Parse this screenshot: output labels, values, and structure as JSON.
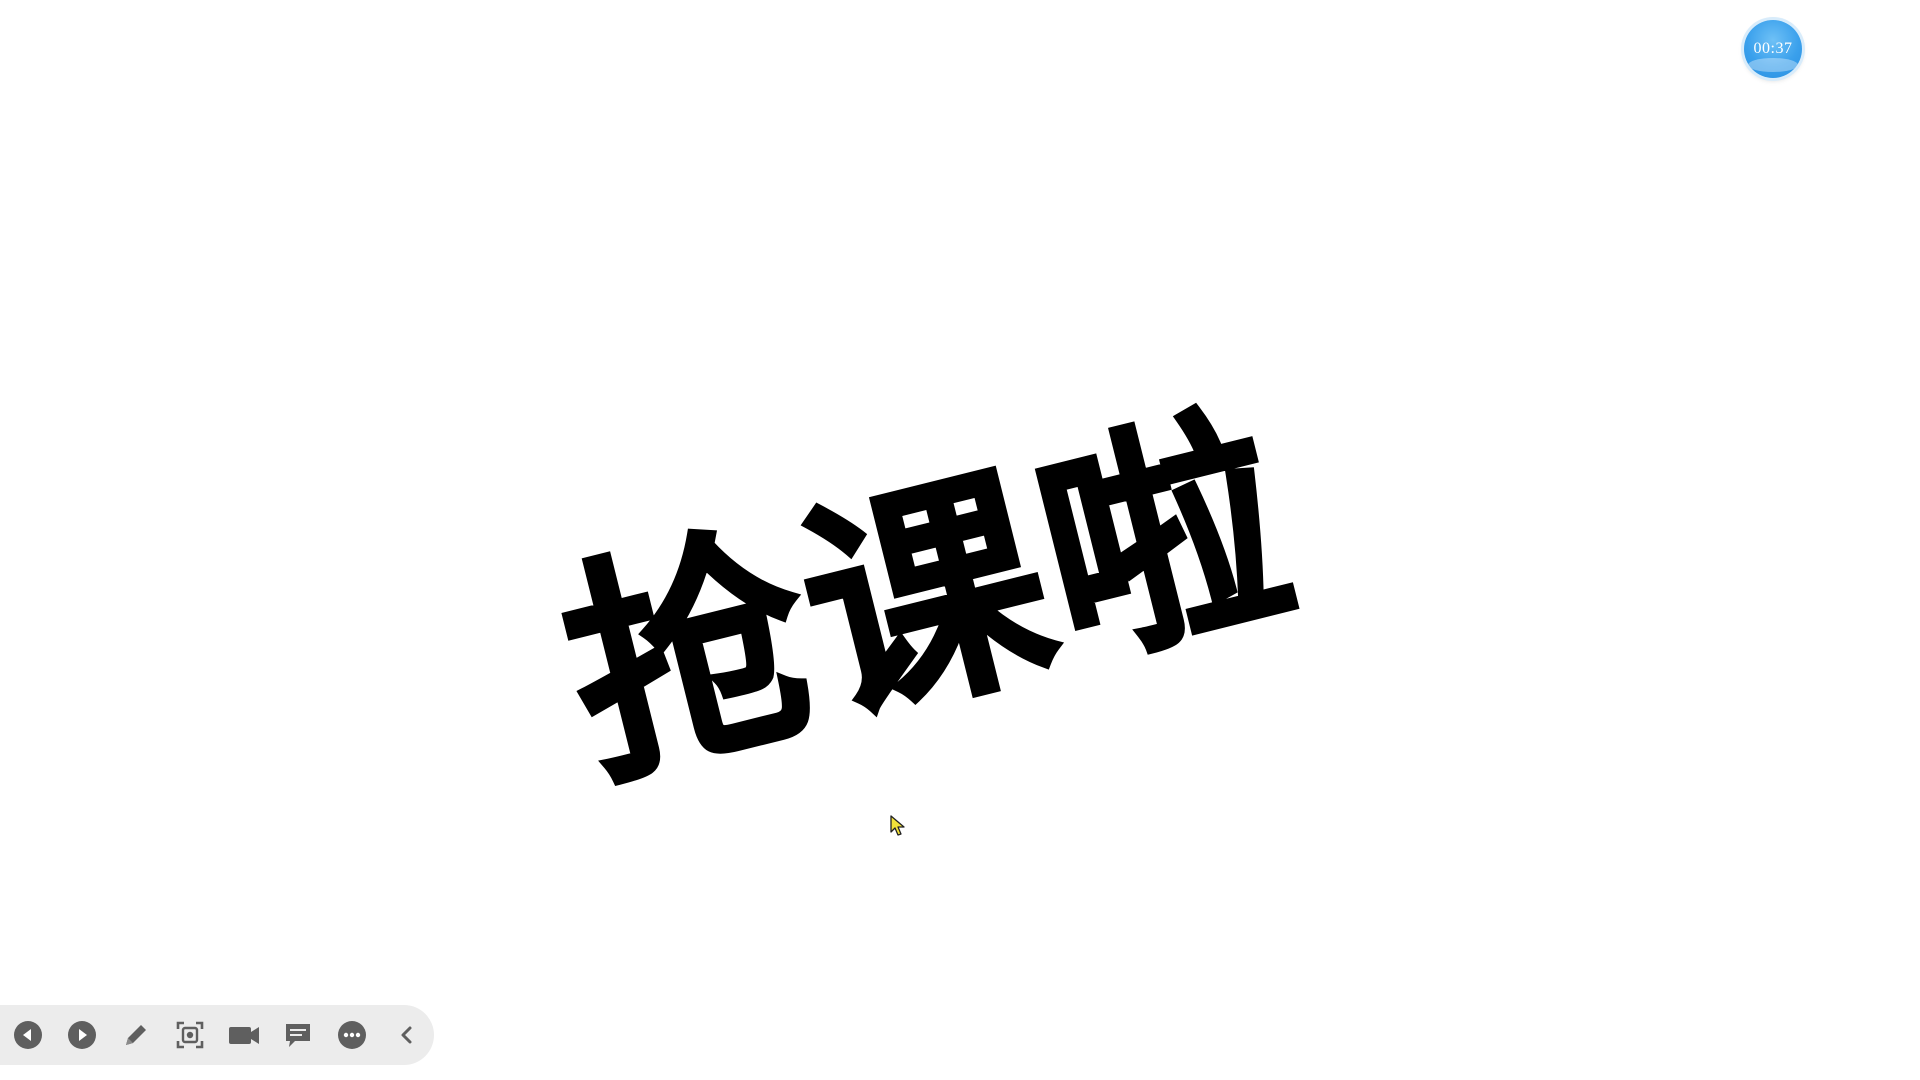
{
  "slide": {
    "title": "抢课啦"
  },
  "timer": {
    "value": "00:37"
  },
  "toolbar": {
    "buttons": [
      {
        "icon": "prev-circle-icon"
      },
      {
        "icon": "next-circle-icon"
      },
      {
        "icon": "pen-icon"
      },
      {
        "icon": "screenshot-icon"
      },
      {
        "icon": "video-camera-icon"
      },
      {
        "icon": "comment-icon"
      },
      {
        "icon": "more-icon"
      },
      {
        "icon": "collapse-chevron-icon"
      }
    ]
  },
  "colors": {
    "background": "#ffffff",
    "text": "#000000",
    "timer": "#3aa0ec",
    "toolbar": "#ececec",
    "icon": "#5f5f5f"
  }
}
